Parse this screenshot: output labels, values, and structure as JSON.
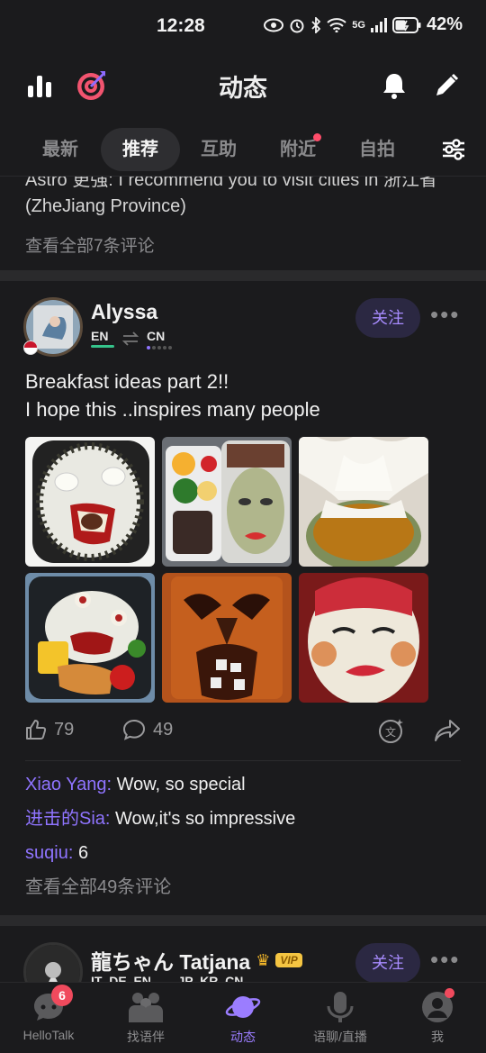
{
  "status_bar": {
    "time": "12:28",
    "network": "5G",
    "battery": "42%"
  },
  "header": {
    "title": "动态"
  },
  "tabs": [
    {
      "label": "最新"
    },
    {
      "label": "推荐",
      "active": true
    },
    {
      "label": "互助"
    },
    {
      "label": "附近",
      "dot": true
    },
    {
      "label": "自拍"
    }
  ],
  "prev_post": {
    "cut_line": "Astro 更强: I recommend you to visit cities in 浙江省",
    "line2": "(ZheJiang Province)",
    "view_all": "查看全部7条评论"
  },
  "post": {
    "username": "Alyssa",
    "native_lang": "EN",
    "learning_lang": "CN",
    "follow_label": "关注",
    "text_line1": "Breakfast ideas part 2!!",
    "text_line2": "I hope this ..inspires many people",
    "likes": "79",
    "comments_count": "49",
    "comments": [
      {
        "name": "Xiao Yang:",
        "text": "Wow, so special"
      },
      {
        "name": "进击的Sia:",
        "text": "Wow,it's so  impressive"
      },
      {
        "name": "suqiu:",
        "text": "6"
      }
    ],
    "view_all": "查看全部49条评论"
  },
  "next_post": {
    "username": "龍ちゃん Tatjana",
    "vip": "VIP",
    "langs": "IT  DE  EN  →  JP  KR  CN",
    "follow_label": "关注"
  },
  "bottom_nav": [
    {
      "label": "HelloTalk",
      "badge": "6"
    },
    {
      "label": "找语伴"
    },
    {
      "label": "动态",
      "active": true
    },
    {
      "label": "语聊/直播"
    },
    {
      "label": "我",
      "dot": true
    }
  ],
  "colors": {
    "accent": "#9b7dff",
    "badge": "#f04a5d",
    "follow_bg": "#2b2842"
  }
}
